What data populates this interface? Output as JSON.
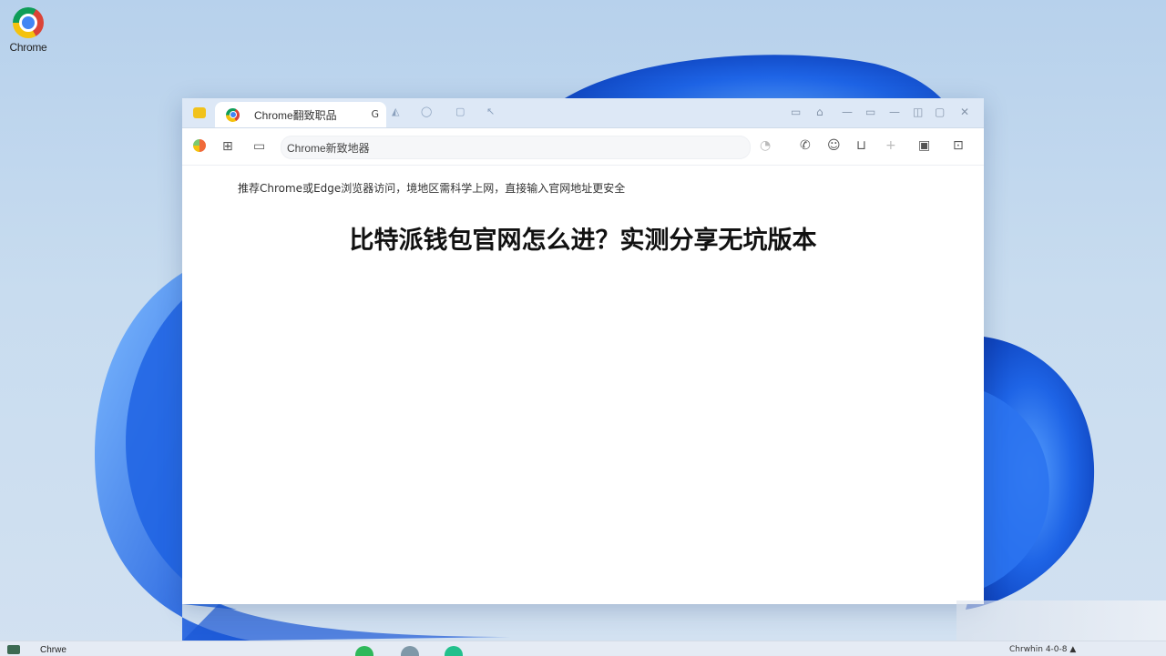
{
  "desktop": {
    "chrome_icon_label": "Chrome"
  },
  "browser": {
    "active_tab_title": "Chrome翻致职品",
    "tab_close_glyph": "G",
    "address_bar_text": "Chrome新致地器"
  },
  "page": {
    "notice_text": "推荐Chrome或Edge浏览器访问，境地区需科学上网，直接输入官网地址更安全",
    "headline": "比特派钱包官网怎么进？实测分享无坑版本"
  },
  "taskbar": {
    "app_label": "Chrwe",
    "tray_text": "Chrwhin   4-0-8   ▲"
  },
  "colors": {
    "wallpaper_blue": "#1a5fe0",
    "tab_strip": "#dde8f6",
    "workspace_tab": "#f1c21b"
  }
}
